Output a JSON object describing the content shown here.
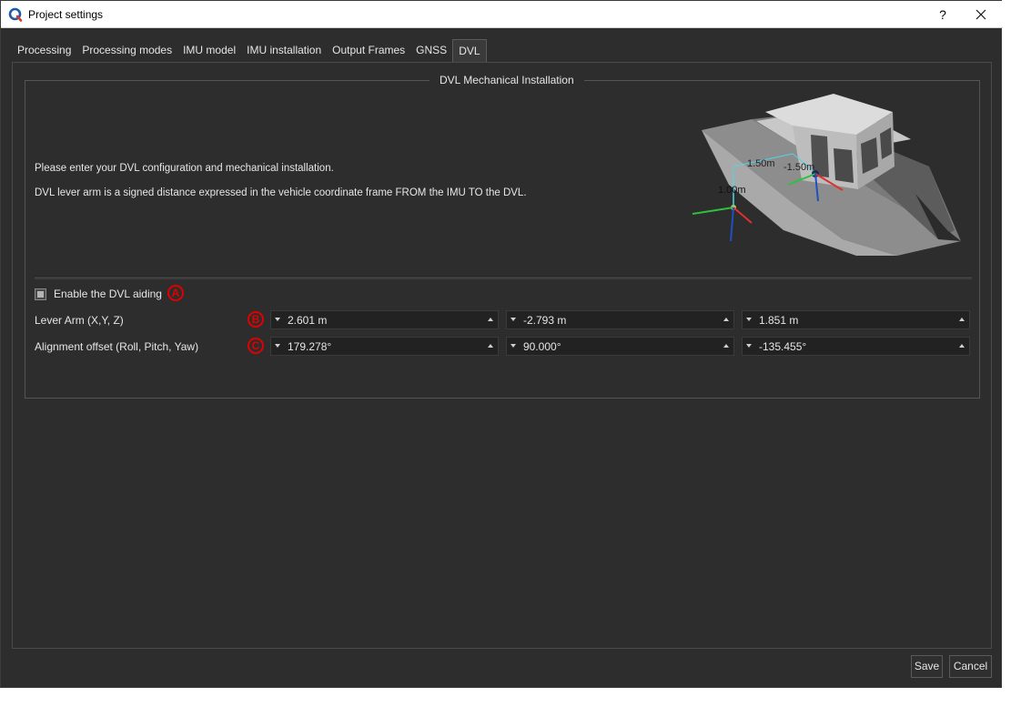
{
  "window": {
    "title": "Project settings",
    "help": "?"
  },
  "tabs": [
    {
      "label": "Processing"
    },
    {
      "label": "Processing modes"
    },
    {
      "label": "IMU model"
    },
    {
      "label": "IMU installation"
    },
    {
      "label": "Output Frames"
    },
    {
      "label": "GNSS"
    },
    {
      "label": "DVL",
      "active": true
    }
  ],
  "dvl": {
    "group_title": "DVL Mechanical Installation",
    "intro_line1": "Please enter your DVL configuration and mechanical installation.",
    "intro_line2": "DVL lever arm is a signed distance expressed in the vehicle coordinate frame FROM the IMU TO the DVL.",
    "illustration": {
      "label_1": "1.50m",
      "label_2": "-1.50m",
      "label_3": "1.00m"
    },
    "enable_label": "Enable the DVL aiding",
    "enable_checked": false,
    "marker_a": "A",
    "marker_b": "B",
    "marker_c": "C",
    "lever_arm_label": "Lever Arm (X,Y, Z)",
    "lever_arm": {
      "x": "2.601 m",
      "y": "-2.793 m",
      "z": "1.851 m"
    },
    "alignment_label": "Alignment offset (Roll, Pitch, Yaw)",
    "alignment": {
      "roll": "179.278°",
      "pitch": "90.000°",
      "yaw": "-135.455°"
    }
  },
  "buttons": {
    "save": "Save",
    "cancel": "Cancel"
  },
  "colors": {
    "window_bg": "#2d2d2d",
    "field_bg": "#222222",
    "marker_red": "#e00000"
  }
}
